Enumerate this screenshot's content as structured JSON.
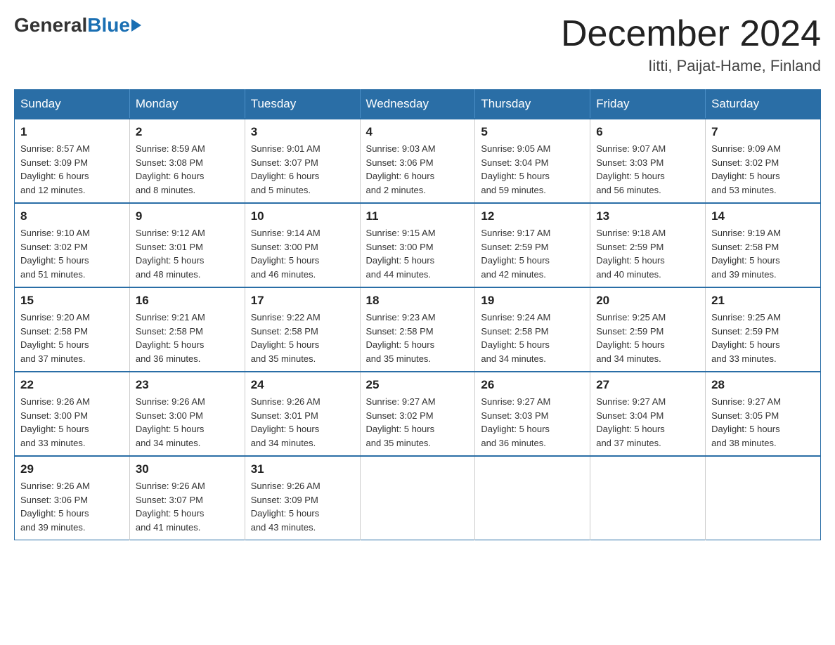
{
  "logo": {
    "general": "General",
    "blue": "Blue"
  },
  "title": {
    "month_year": "December 2024",
    "location": "Iitti, Paijat-Hame, Finland"
  },
  "weekdays": [
    "Sunday",
    "Monday",
    "Tuesday",
    "Wednesday",
    "Thursday",
    "Friday",
    "Saturday"
  ],
  "weeks": [
    [
      {
        "day": "1",
        "sunrise": "8:57 AM",
        "sunset": "3:09 PM",
        "daylight": "6 hours and 12 minutes."
      },
      {
        "day": "2",
        "sunrise": "8:59 AM",
        "sunset": "3:08 PM",
        "daylight": "6 hours and 8 minutes."
      },
      {
        "day": "3",
        "sunrise": "9:01 AM",
        "sunset": "3:07 PM",
        "daylight": "6 hours and 5 minutes."
      },
      {
        "day": "4",
        "sunrise": "9:03 AM",
        "sunset": "3:06 PM",
        "daylight": "6 hours and 2 minutes."
      },
      {
        "day": "5",
        "sunrise": "9:05 AM",
        "sunset": "3:04 PM",
        "daylight": "5 hours and 59 minutes."
      },
      {
        "day": "6",
        "sunrise": "9:07 AM",
        "sunset": "3:03 PM",
        "daylight": "5 hours and 56 minutes."
      },
      {
        "day": "7",
        "sunrise": "9:09 AM",
        "sunset": "3:02 PM",
        "daylight": "5 hours and 53 minutes."
      }
    ],
    [
      {
        "day": "8",
        "sunrise": "9:10 AM",
        "sunset": "3:02 PM",
        "daylight": "5 hours and 51 minutes."
      },
      {
        "day": "9",
        "sunrise": "9:12 AM",
        "sunset": "3:01 PM",
        "daylight": "5 hours and 48 minutes."
      },
      {
        "day": "10",
        "sunrise": "9:14 AM",
        "sunset": "3:00 PM",
        "daylight": "5 hours and 46 minutes."
      },
      {
        "day": "11",
        "sunrise": "9:15 AM",
        "sunset": "3:00 PM",
        "daylight": "5 hours and 44 minutes."
      },
      {
        "day": "12",
        "sunrise": "9:17 AM",
        "sunset": "2:59 PM",
        "daylight": "5 hours and 42 minutes."
      },
      {
        "day": "13",
        "sunrise": "9:18 AM",
        "sunset": "2:59 PM",
        "daylight": "5 hours and 40 minutes."
      },
      {
        "day": "14",
        "sunrise": "9:19 AM",
        "sunset": "2:58 PM",
        "daylight": "5 hours and 39 minutes."
      }
    ],
    [
      {
        "day": "15",
        "sunrise": "9:20 AM",
        "sunset": "2:58 PM",
        "daylight": "5 hours and 37 minutes."
      },
      {
        "day": "16",
        "sunrise": "9:21 AM",
        "sunset": "2:58 PM",
        "daylight": "5 hours and 36 minutes."
      },
      {
        "day": "17",
        "sunrise": "9:22 AM",
        "sunset": "2:58 PM",
        "daylight": "5 hours and 35 minutes."
      },
      {
        "day": "18",
        "sunrise": "9:23 AM",
        "sunset": "2:58 PM",
        "daylight": "5 hours and 35 minutes."
      },
      {
        "day": "19",
        "sunrise": "9:24 AM",
        "sunset": "2:58 PM",
        "daylight": "5 hours and 34 minutes."
      },
      {
        "day": "20",
        "sunrise": "9:25 AM",
        "sunset": "2:59 PM",
        "daylight": "5 hours and 34 minutes."
      },
      {
        "day": "21",
        "sunrise": "9:25 AM",
        "sunset": "2:59 PM",
        "daylight": "5 hours and 33 minutes."
      }
    ],
    [
      {
        "day": "22",
        "sunrise": "9:26 AM",
        "sunset": "3:00 PM",
        "daylight": "5 hours and 33 minutes."
      },
      {
        "day": "23",
        "sunrise": "9:26 AM",
        "sunset": "3:00 PM",
        "daylight": "5 hours and 34 minutes."
      },
      {
        "day": "24",
        "sunrise": "9:26 AM",
        "sunset": "3:01 PM",
        "daylight": "5 hours and 34 minutes."
      },
      {
        "day": "25",
        "sunrise": "9:27 AM",
        "sunset": "3:02 PM",
        "daylight": "5 hours and 35 minutes."
      },
      {
        "day": "26",
        "sunrise": "9:27 AM",
        "sunset": "3:03 PM",
        "daylight": "5 hours and 36 minutes."
      },
      {
        "day": "27",
        "sunrise": "9:27 AM",
        "sunset": "3:04 PM",
        "daylight": "5 hours and 37 minutes."
      },
      {
        "day": "28",
        "sunrise": "9:27 AM",
        "sunset": "3:05 PM",
        "daylight": "5 hours and 38 minutes."
      }
    ],
    [
      {
        "day": "29",
        "sunrise": "9:26 AM",
        "sunset": "3:06 PM",
        "daylight": "5 hours and 39 minutes."
      },
      {
        "day": "30",
        "sunrise": "9:26 AM",
        "sunset": "3:07 PM",
        "daylight": "5 hours and 41 minutes."
      },
      {
        "day": "31",
        "sunrise": "9:26 AM",
        "sunset": "3:09 PM",
        "daylight": "5 hours and 43 minutes."
      },
      null,
      null,
      null,
      null
    ]
  ],
  "labels": {
    "sunrise": "Sunrise:",
    "sunset": "Sunset:",
    "daylight": "Daylight:"
  }
}
